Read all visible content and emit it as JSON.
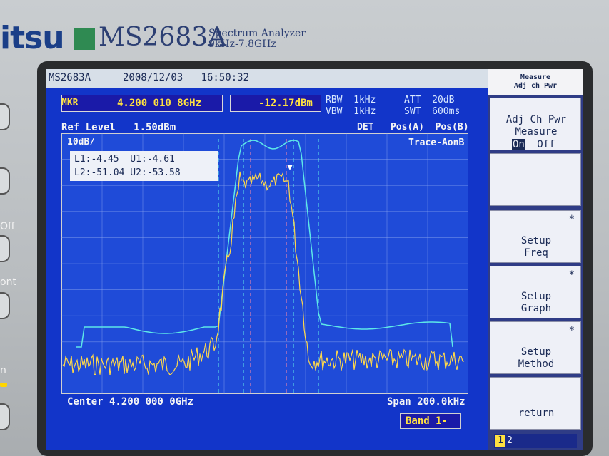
{
  "brand": {
    "logo_fragment": "itsu",
    "model": "MS2683A",
    "description_line1": "Spectrum Analyzer",
    "description_line2": "9kHz-7.8GHz"
  },
  "side_panel": {
    "label_off": "Off",
    "label_ont": "ont",
    "label_n": "n"
  },
  "status": {
    "model": "MS2683A",
    "date_time": "2008/12/03   16:50:32"
  },
  "marker": {
    "label": "MKR",
    "frequency": "4.200 010 8GHz",
    "level": "-12.17dBm"
  },
  "params": {
    "rbw": "RBW  1kHz",
    "vbw": "VBW  1kHz",
    "att": "ATT  20dB",
    "swt": "SWT  600ms"
  },
  "graph": {
    "ref_level": "Ref Level   1.50dBm",
    "det": "DET   Pos(A)  Pos(B)",
    "trace_mode": "Trace-AonB",
    "scale": "10dB/",
    "adj_line1": "L1:-4.45  U1:-4.61",
    "adj_line2": "L2:-51.04 U2:-53.58",
    "center": "Center 4.200 000 0GHz",
    "span": "Span 200.0kHz",
    "band": "Band 1-"
  },
  "menu": {
    "title_line1": "Measure",
    "title_line2": "Adj ch Pwr",
    "key1_line1": "Adj Ch Pwr",
    "key1_line2": "Measure",
    "key1_on": "On",
    "key1_off": "Off",
    "key3_line1": "Setup",
    "key3_line2": "Freq",
    "key4_line1": "Setup",
    "key4_line2": "Graph",
    "key5_line1": "Setup",
    "key5_line2": "Method",
    "key6": "return",
    "page_current": "1",
    "page_other": "2",
    "star": "*"
  },
  "colors": {
    "screen_bg": "#1235c9",
    "graph_bg": "#1f4bd8",
    "trace_a": "#ffd84a",
    "trace_b": "#5de8e8",
    "marker_text": "#ffe040"
  }
}
